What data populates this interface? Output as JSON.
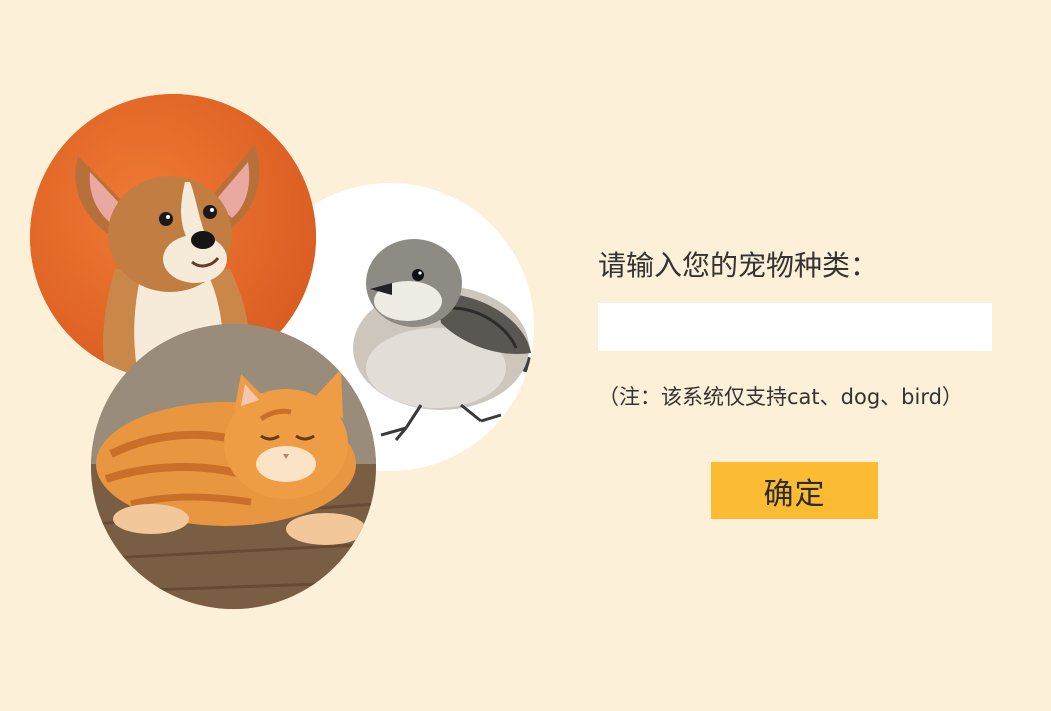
{
  "form": {
    "prompt_label": "请输入您的宠物种类：",
    "input_value": "",
    "note": "（注：该系统仅支持cat、dog、bird）",
    "confirm_label": "确定"
  },
  "images": {
    "dog": "dog",
    "bird": "bird",
    "cat": "cat"
  },
  "colors": {
    "background": "#fdf0d8",
    "button": "#fbbb33",
    "input_bg": "#ffffff",
    "dog_bg": "#e8692a"
  }
}
